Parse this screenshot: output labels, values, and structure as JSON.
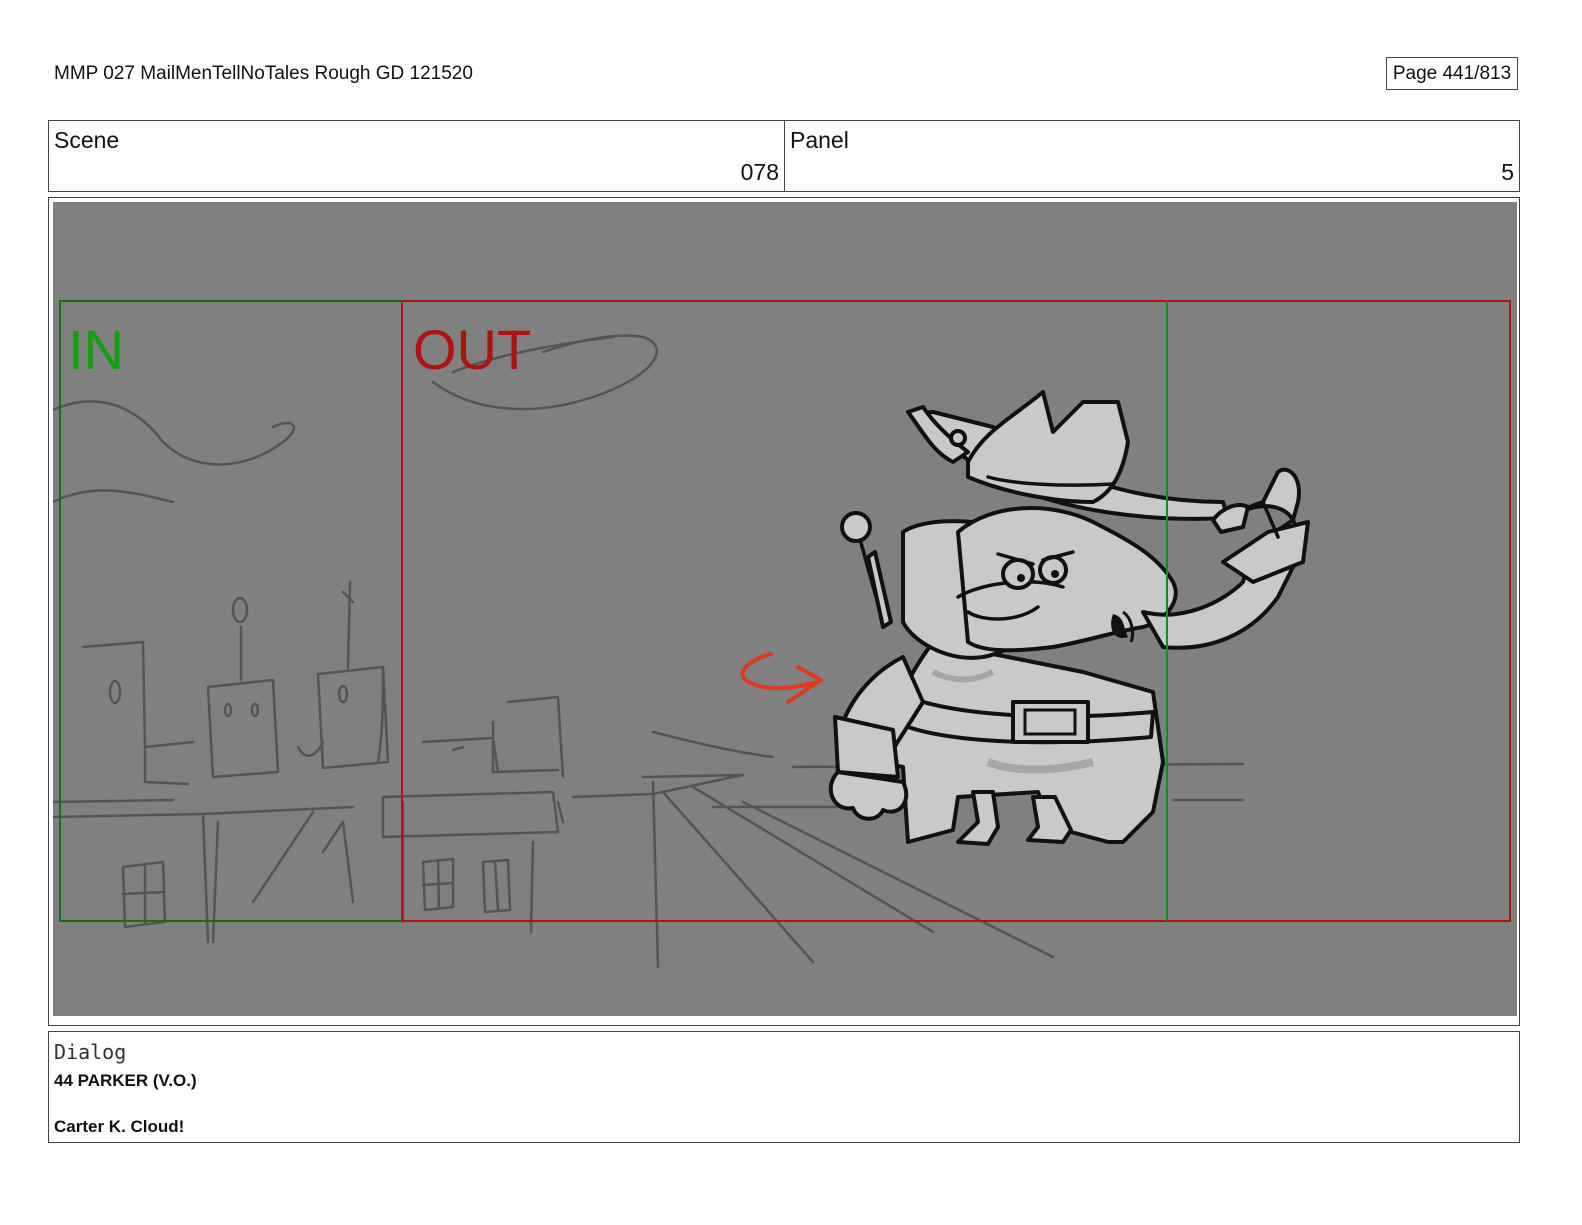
{
  "header": {
    "title": "MMP 027 MailMenTellNoTales Rough GD 121520",
    "page": "Page 441/813"
  },
  "scene": {
    "label": "Scene",
    "value": "078"
  },
  "panel": {
    "label": "Panel",
    "value": "5"
  },
  "frame": {
    "in_label": "IN",
    "out_label": "OUT",
    "in_color": "#119911",
    "out_color": "#aa1111",
    "background": "#808080"
  },
  "dialog": {
    "label": "Dialog",
    "speaker": "44 PARKER (V.O.)",
    "line": "Carter K. Cloud!"
  }
}
